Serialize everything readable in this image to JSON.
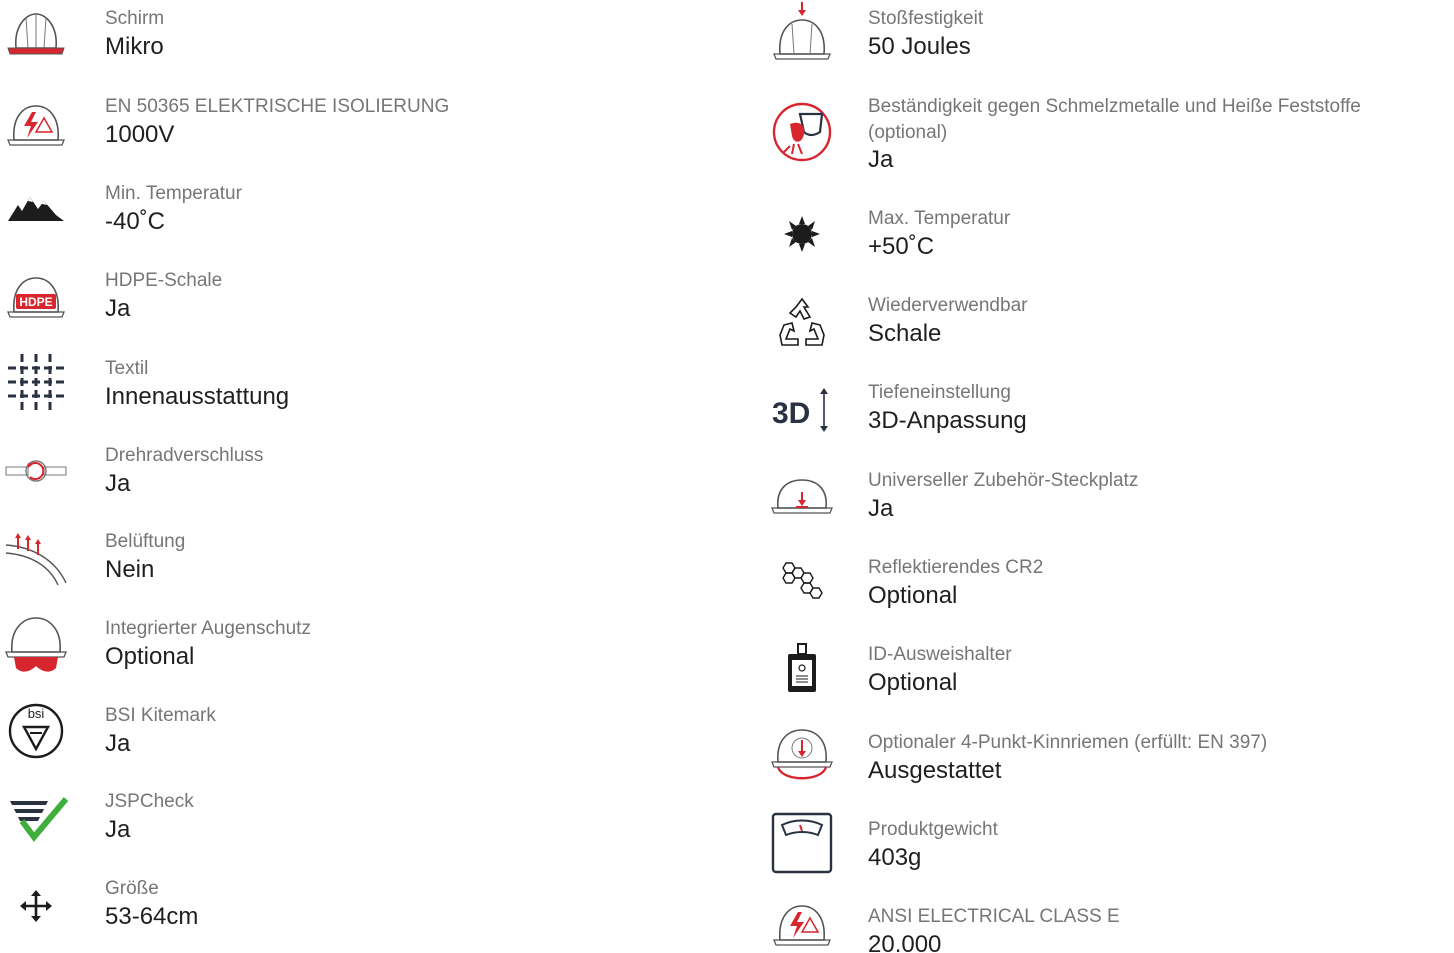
{
  "left_column": [
    {
      "label": "Schirm",
      "value": "Mikro",
      "icon": "helmet-peak-icon"
    },
    {
      "label": "EN 50365 ELEKTRISCHE ISOLIERUNG",
      "value": "1000V",
      "icon": "electrical-helmet-icon"
    },
    {
      "label": "Min. Temperatur",
      "value": "-40˚C",
      "icon": "mountains-icon"
    },
    {
      "label": "HDPE-Schale",
      "value": "Ja",
      "icon": "hdpe-helmet-icon"
    },
    {
      "label": "Textil",
      "value": "Innenausstattung",
      "icon": "textile-grid-icon"
    },
    {
      "label": "Drehradverschluss",
      "value": "Ja",
      "icon": "ratchet-wheel-icon"
    },
    {
      "label": "Belüftung",
      "value": "Nein",
      "icon": "ventilation-icon"
    },
    {
      "label": "Integrierter Augenschutz",
      "value": "Optional",
      "icon": "helmet-visor-icon"
    },
    {
      "label": "BSI Kitemark",
      "value": "Ja",
      "icon": "bsi-kitemark-icon",
      "icon_text": "bsi"
    },
    {
      "label": "JSPCheck",
      "value": "Ja",
      "icon": "jspcheck-icon"
    },
    {
      "label": "Größe",
      "value": "53-64cm",
      "icon": "resize-arrows-icon"
    }
  ],
  "right_column": [
    {
      "label": "Stoßfestigkeit",
      "value": "50 Joules",
      "icon": "impact-helmet-icon"
    },
    {
      "label": "Beständigkeit gegen Schmelzmetalle und Heiße Feststoffe",
      "label_line2": "(optional)",
      "value": "Ja",
      "icon": "molten-metal-icon"
    },
    {
      "label": "Max. Temperatur",
      "value": "+50˚C",
      "icon": "sun-icon"
    },
    {
      "label": "Wiederverwendbar",
      "value": "Schale",
      "icon": "recycle-icon"
    },
    {
      "label": "Tiefeneinstellung",
      "value": "3D-Anpassung",
      "icon": "depth-3d-icon",
      "icon_text": "3D"
    },
    {
      "label": "Universeller Zubehör-Steckplatz",
      "value": "Ja",
      "icon": "accessory-slot-icon"
    },
    {
      "label": "Reflektierendes CR2",
      "value": "Optional",
      "icon": "hexagons-icon"
    },
    {
      "label": "ID-Ausweishalter",
      "value": "Optional",
      "icon": "id-badge-icon"
    },
    {
      "label": "Optionaler 4-Punkt-Kinnriemen (erfüllt: EN 397)",
      "value": "Ausgestattet",
      "icon": "chinstrap-helmet-icon"
    },
    {
      "label": "Produktgewicht",
      "value": "403g",
      "icon": "weight-scale-icon"
    },
    {
      "label": "ANSI ELECTRICAL CLASS E",
      "value": "20.000",
      "icon": "ansi-electrical-icon"
    }
  ],
  "colors": {
    "accent": "#d7262d",
    "label": "#767676",
    "value": "#1f1f1f",
    "icon_dark": "#2a3140",
    "check": "#3fae3a"
  }
}
